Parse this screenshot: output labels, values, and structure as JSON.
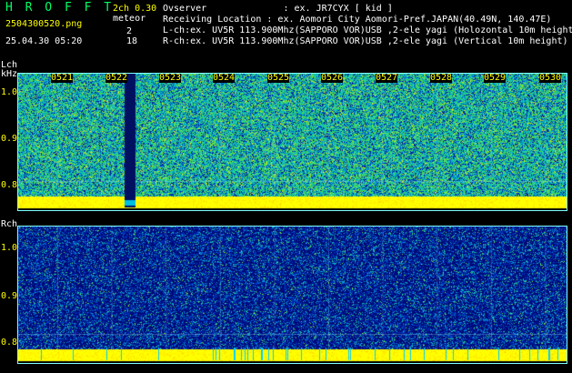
{
  "header": {
    "app_title": "H R O F F T",
    "mode": "2ch 0.30",
    "filename": "2504300520.png",
    "datetime": "25.04.30 05:20",
    "meteor_label": "meteor",
    "meteor_l_count": "2",
    "meteor_r_count": "18"
  },
  "info": {
    "observer": "Ovserver              : ex. JR7CYX [ kid ]",
    "location": "Receiving Location : ex. Aomori City Aomori-Pref.JAPAN(40.49N, 140.47E)",
    "lch": "L-ch:ex. UV5R 113.900Mhz(SAPPORO VOR)USB ,2-ele yagi (Holozontal 10m height)",
    "rch": "R-ch:ex. UV5R 113.900Mhz(SAPPORO VOR)USB ,2-ele yagi (Vertical 10m height)"
  },
  "panels": {
    "left": {
      "label": "Lch",
      "unit": "kHz"
    },
    "right": {
      "label": "Rch"
    }
  },
  "time_ticks": [
    "0521",
    "0522",
    "0523",
    "0524",
    "0525",
    "0526",
    "0527",
    "0528",
    "0529",
    "0530"
  ],
  "freq_ticks_l": [
    "1.0",
    "0.9",
    "0.8"
  ],
  "freq_ticks_r": [
    "1.0",
    "0.9",
    "0.8"
  ],
  "colors": {
    "background": "#000000",
    "text": "#ffffff",
    "axis_text": "#ffff00",
    "title": "#00ff66",
    "frame": "#7fffff",
    "noise_floor": "#ffff00"
  }
}
